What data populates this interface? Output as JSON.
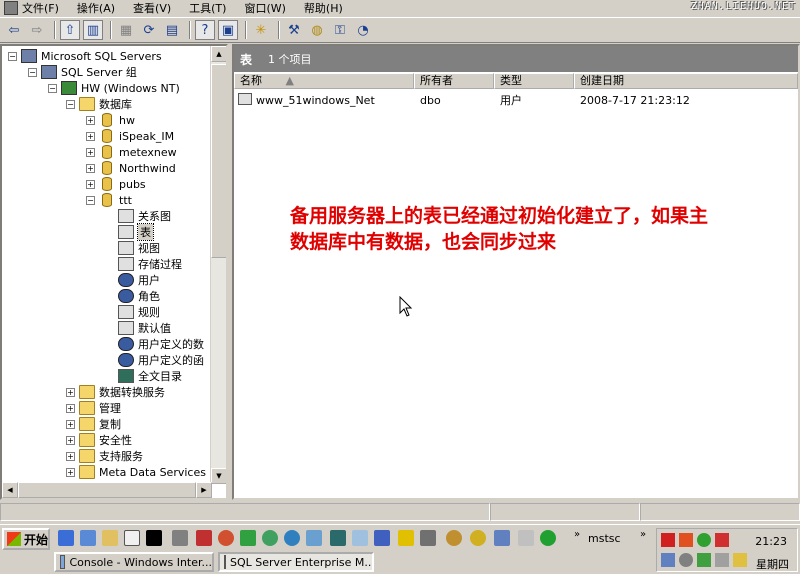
{
  "menu": {
    "items": [
      "文件(F)",
      "操作(A)",
      "查看(V)",
      "工具(T)",
      "窗口(W)",
      "帮助(H)"
    ],
    "watermark": "ZHAN.LIEHUO.NET"
  },
  "toolbar": {
    "buttons": [
      "back-icon",
      "forward-icon",
      "up-folder-icon",
      "show-tree-icon",
      "properties-icon",
      "refresh-icon",
      "export-icon",
      "help-icon",
      "console-icon",
      "wizard-icon",
      "tools-icon",
      "database-icon",
      "security-icon",
      "schedule-icon"
    ]
  },
  "tree": {
    "root": "Microsoft SQL Servers",
    "group": "SQL Server 组",
    "server": "HW (Windows NT)",
    "databases_label": "数据库",
    "databases": [
      "hw",
      "iSpeak_IM",
      "metexnew",
      "Northwind",
      "pubs",
      "ttt"
    ],
    "ttt_children": [
      "关系图",
      "表",
      "视图",
      "存储过程",
      "用户",
      "角色",
      "规则",
      "默认值",
      "用户定义的数",
      "用户定义的函",
      "全文目录"
    ],
    "server_children": [
      "数据转换服务",
      "管理",
      "复制",
      "安全性",
      "支持服务",
      "Meta Data Services"
    ]
  },
  "pane": {
    "title": "表",
    "count": "1 个项目",
    "columns": [
      "名称",
      "所有者",
      "类型",
      "创建日期"
    ],
    "rows": [
      {
        "name": "www_51windows_Net",
        "owner": "dbo",
        "type": "用户",
        "created": "2008-7-17 21:23:12"
      }
    ]
  },
  "annotation": {
    "line1": "备用服务器上的表已经通过初始化建立了，如果主",
    "line2": "数据库中有数据，也会同步过来"
  },
  "taskbar": {
    "start": "开始",
    "running_label": "mstsc",
    "tasks": [
      "Console - Windows Inter...",
      "SQL Server Enterprise M..."
    ],
    "clock": "21:23",
    "day": "星期四"
  },
  "colors": {
    "annotation": "#e00000",
    "pane_title_bg": "#808080",
    "window_bg": "#d4d0c8"
  }
}
